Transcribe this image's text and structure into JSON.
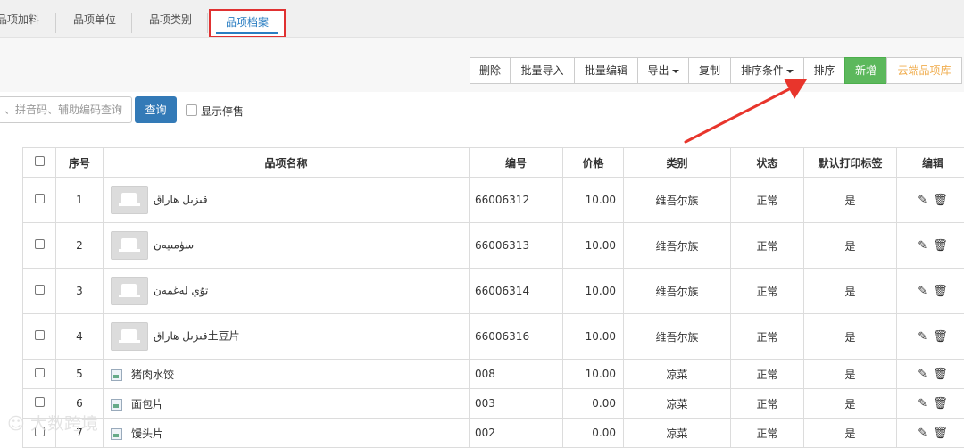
{
  "tabs": [
    "品项加料",
    "品项单位",
    "品项类别",
    "品项档案"
  ],
  "toolbar": {
    "delete": "删除",
    "batch_import": "批量导入",
    "batch_edit": "批量编辑",
    "export": "导出",
    "copy": "复制",
    "sort_condition": "排序条件",
    "sort": "排序",
    "add_new": "新增",
    "cloud_library": "云端品项库"
  },
  "search": {
    "placeholder": "、拼音码、辅助编码查询",
    "query_label": "查询",
    "show_stopped_label": "显示停售"
  },
  "table": {
    "headers": [
      "序号",
      "品项名称",
      "编号",
      "价格",
      "类别",
      "状态",
      "默认打印标签",
      "编辑"
    ],
    "rows": [
      {
        "seq": "1",
        "name": "قىزىل ھاراق",
        "code": "66006312",
        "price": "10.00",
        "category": "维吾尔族",
        "status": "正常",
        "print_label": "是",
        "img": "thumb"
      },
      {
        "seq": "2",
        "name": "سۈمىيەن",
        "code": "66006313",
        "price": "10.00",
        "category": "维吾尔族",
        "status": "正常",
        "print_label": "是",
        "img": "thumb"
      },
      {
        "seq": "3",
        "name": "تۇي لەغمەن",
        "code": "66006314",
        "price": "10.00",
        "category": "维吾尔族",
        "status": "正常",
        "print_label": "是",
        "img": "thumb"
      },
      {
        "seq": "4",
        "name": "قىزىل ھاراق土豆片",
        "code": "66006316",
        "price": "10.00",
        "category": "维吾尔族",
        "status": "正常",
        "print_label": "是",
        "img": "thumb"
      },
      {
        "seq": "5",
        "name": "猪肉水饺",
        "code": "008",
        "price": "10.00",
        "category": "凉菜",
        "status": "正常",
        "print_label": "是",
        "img": "broken"
      },
      {
        "seq": "6",
        "name": "面包片",
        "code": "003",
        "price": "0.00",
        "category": "凉菜",
        "status": "正常",
        "print_label": "是",
        "img": "broken"
      },
      {
        "seq": "7",
        "name": "馒头片",
        "code": "002",
        "price": "0.00",
        "category": "凉菜",
        "status": "正常",
        "print_label": "是",
        "img": "broken"
      }
    ]
  },
  "watermark": "大数跨境",
  "colors": {
    "primary": "#337ab7",
    "success": "#5cb85c",
    "warning": "#f0ad4e",
    "highlight": "#e03131",
    "tab_active": "#2a7ec2"
  }
}
